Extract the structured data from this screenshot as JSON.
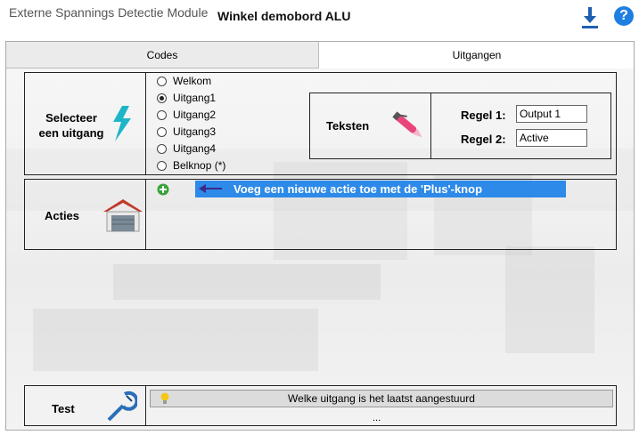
{
  "header": {
    "app_title": "Externe Spannings Detectie Module",
    "board_title": "Winkel demobord ALU"
  },
  "tabs": [
    {
      "label": "Codes"
    },
    {
      "label": "Uitgangen"
    }
  ],
  "select_output": {
    "label": "Selecteer een uitgang",
    "options": [
      {
        "label": "Welkom",
        "selected": false
      },
      {
        "label": "Uitgang1",
        "selected": true
      },
      {
        "label": "Uitgang2",
        "selected": false
      },
      {
        "label": "Uitgang3",
        "selected": false
      },
      {
        "label": "Uitgang4",
        "selected": false
      },
      {
        "label": "Belknop (*)",
        "selected": false
      }
    ]
  },
  "texts": {
    "label": "Teksten",
    "line1_label": "Regel 1:",
    "line1_value": "Output 1",
    "line2_label": "Regel 2:",
    "line2_value": "Active"
  },
  "actions": {
    "label": "Acties",
    "hint": "Voeg een nieuwe actie toe met de 'Plus'-knop"
  },
  "test": {
    "label": "Test",
    "status": "Welke uitgang is het laatst aangestuurd",
    "ellipsis": "..."
  },
  "colors": {
    "accent": "#2d8ae8",
    "help": "#1e7fe0",
    "download": "#1f5fb0"
  },
  "icons": [
    "download-icon",
    "help-icon",
    "lightning-icon",
    "pen-icon",
    "garage-icon",
    "plus-icon",
    "arrow-left-icon",
    "multimeter-icon",
    "lightbulb-icon"
  ]
}
